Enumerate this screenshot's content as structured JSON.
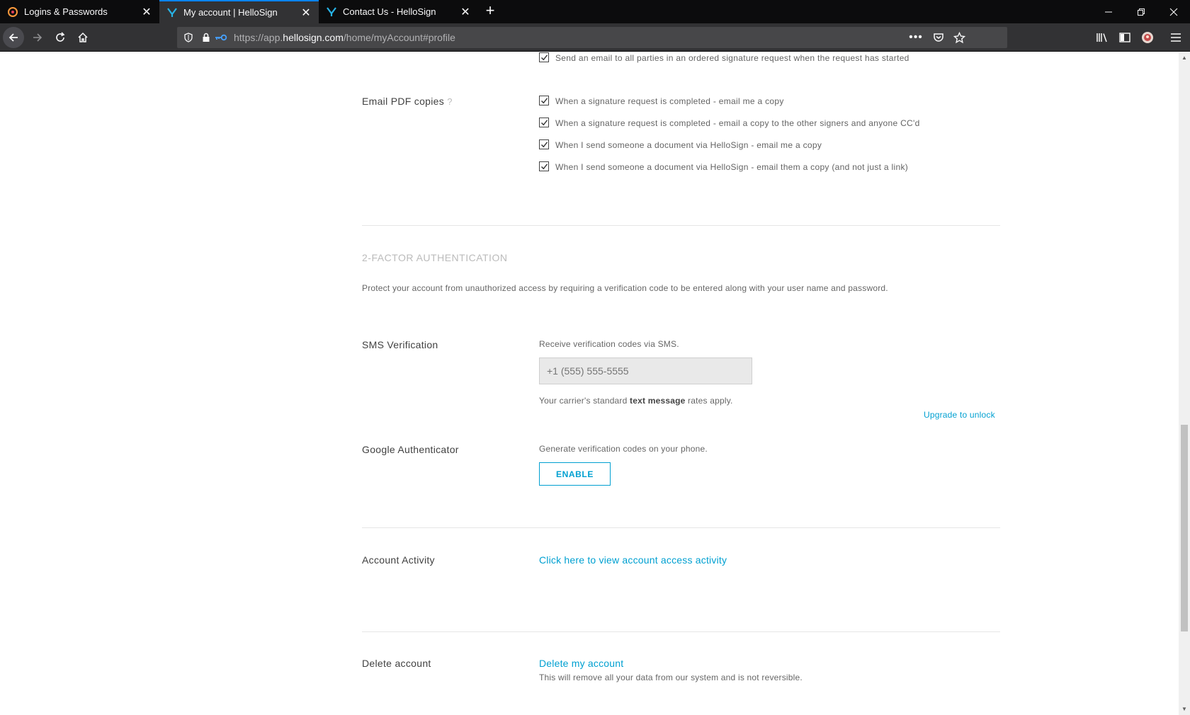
{
  "browser": {
    "tabs": [
      {
        "label": "Logins & Passwords",
        "icon": "lockwise-icon",
        "active": false
      },
      {
        "label": "My account | HelloSign",
        "icon": "hellosign-icon",
        "active": true
      },
      {
        "label": "Contact Us - HelloSign",
        "icon": "hellosign-icon",
        "active": false
      }
    ],
    "url_prefix": "https://app.",
    "url_domain": "hellosign.com",
    "url_path": "/home/myAccount#profile"
  },
  "notifications": {
    "started_label": "Send an email to all parties in an ordered signature request when the request has started"
  },
  "pdf_copies": {
    "label": "Email PDF copies",
    "help": "?",
    "options": [
      "When a signature request is completed - email me a copy",
      "When a signature request is completed - email a copy to the other signers and anyone CC'd",
      "When I send someone a document via HelloSign - email me a copy",
      "When I send someone a document via HelloSign - email them a copy (and not just a link)"
    ]
  },
  "two_factor": {
    "heading": "2-FACTOR AUTHENTICATION",
    "description": "Protect your account from unauthorized access by requiring a verification code to be entered along with your user name and password.",
    "sms": {
      "label": "SMS Verification",
      "hint": "Receive verification codes via SMS.",
      "placeholder": "+1 (555) 555-5555",
      "note_before": "Your carrier's standard ",
      "note_bold": "text message",
      "note_after": " rates apply.",
      "upgrade": "Upgrade to unlock"
    },
    "google": {
      "label": "Google Authenticator",
      "hint": "Generate verification codes on your phone.",
      "button": "ENABLE"
    }
  },
  "activity": {
    "label": "Account Activity",
    "link": "Click here to view account access activity"
  },
  "delete": {
    "label": "Delete account",
    "link": "Delete my account",
    "note": "This will remove all your data from our system and is not reversible."
  },
  "colors": {
    "accent": "#00a0d1",
    "tab_highlight": "#0a84ff"
  }
}
